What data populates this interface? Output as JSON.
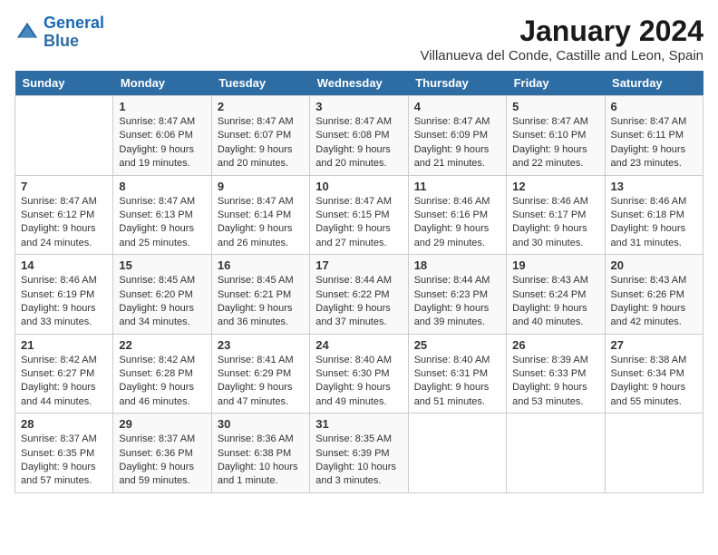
{
  "logo": {
    "line1": "General",
    "line2": "Blue"
  },
  "title": "January 2024",
  "subtitle": "Villanueva del Conde, Castille and Leon, Spain",
  "weekdays": [
    "Sunday",
    "Monday",
    "Tuesday",
    "Wednesday",
    "Thursday",
    "Friday",
    "Saturday"
  ],
  "weeks": [
    [
      {
        "day": "",
        "sunrise": "",
        "sunset": "",
        "daylight": ""
      },
      {
        "day": "1",
        "sunrise": "Sunrise: 8:47 AM",
        "sunset": "Sunset: 6:06 PM",
        "daylight": "Daylight: 9 hours and 19 minutes."
      },
      {
        "day": "2",
        "sunrise": "Sunrise: 8:47 AM",
        "sunset": "Sunset: 6:07 PM",
        "daylight": "Daylight: 9 hours and 20 minutes."
      },
      {
        "day": "3",
        "sunrise": "Sunrise: 8:47 AM",
        "sunset": "Sunset: 6:08 PM",
        "daylight": "Daylight: 9 hours and 20 minutes."
      },
      {
        "day": "4",
        "sunrise": "Sunrise: 8:47 AM",
        "sunset": "Sunset: 6:09 PM",
        "daylight": "Daylight: 9 hours and 21 minutes."
      },
      {
        "day": "5",
        "sunrise": "Sunrise: 8:47 AM",
        "sunset": "Sunset: 6:10 PM",
        "daylight": "Daylight: 9 hours and 22 minutes."
      },
      {
        "day": "6",
        "sunrise": "Sunrise: 8:47 AM",
        "sunset": "Sunset: 6:11 PM",
        "daylight": "Daylight: 9 hours and 23 minutes."
      }
    ],
    [
      {
        "day": "7",
        "sunrise": "Sunrise: 8:47 AM",
        "sunset": "Sunset: 6:12 PM",
        "daylight": "Daylight: 9 hours and 24 minutes."
      },
      {
        "day": "8",
        "sunrise": "Sunrise: 8:47 AM",
        "sunset": "Sunset: 6:13 PM",
        "daylight": "Daylight: 9 hours and 25 minutes."
      },
      {
        "day": "9",
        "sunrise": "Sunrise: 8:47 AM",
        "sunset": "Sunset: 6:14 PM",
        "daylight": "Daylight: 9 hours and 26 minutes."
      },
      {
        "day": "10",
        "sunrise": "Sunrise: 8:47 AM",
        "sunset": "Sunset: 6:15 PM",
        "daylight": "Daylight: 9 hours and 27 minutes."
      },
      {
        "day": "11",
        "sunrise": "Sunrise: 8:46 AM",
        "sunset": "Sunset: 6:16 PM",
        "daylight": "Daylight: 9 hours and 29 minutes."
      },
      {
        "day": "12",
        "sunrise": "Sunrise: 8:46 AM",
        "sunset": "Sunset: 6:17 PM",
        "daylight": "Daylight: 9 hours and 30 minutes."
      },
      {
        "day": "13",
        "sunrise": "Sunrise: 8:46 AM",
        "sunset": "Sunset: 6:18 PM",
        "daylight": "Daylight: 9 hours and 31 minutes."
      }
    ],
    [
      {
        "day": "14",
        "sunrise": "Sunrise: 8:46 AM",
        "sunset": "Sunset: 6:19 PM",
        "daylight": "Daylight: 9 hours and 33 minutes."
      },
      {
        "day": "15",
        "sunrise": "Sunrise: 8:45 AM",
        "sunset": "Sunset: 6:20 PM",
        "daylight": "Daylight: 9 hours and 34 minutes."
      },
      {
        "day": "16",
        "sunrise": "Sunrise: 8:45 AM",
        "sunset": "Sunset: 6:21 PM",
        "daylight": "Daylight: 9 hours and 36 minutes."
      },
      {
        "day": "17",
        "sunrise": "Sunrise: 8:44 AM",
        "sunset": "Sunset: 6:22 PM",
        "daylight": "Daylight: 9 hours and 37 minutes."
      },
      {
        "day": "18",
        "sunrise": "Sunrise: 8:44 AM",
        "sunset": "Sunset: 6:23 PM",
        "daylight": "Daylight: 9 hours and 39 minutes."
      },
      {
        "day": "19",
        "sunrise": "Sunrise: 8:43 AM",
        "sunset": "Sunset: 6:24 PM",
        "daylight": "Daylight: 9 hours and 40 minutes."
      },
      {
        "day": "20",
        "sunrise": "Sunrise: 8:43 AM",
        "sunset": "Sunset: 6:26 PM",
        "daylight": "Daylight: 9 hours and 42 minutes."
      }
    ],
    [
      {
        "day": "21",
        "sunrise": "Sunrise: 8:42 AM",
        "sunset": "Sunset: 6:27 PM",
        "daylight": "Daylight: 9 hours and 44 minutes."
      },
      {
        "day": "22",
        "sunrise": "Sunrise: 8:42 AM",
        "sunset": "Sunset: 6:28 PM",
        "daylight": "Daylight: 9 hours and 46 minutes."
      },
      {
        "day": "23",
        "sunrise": "Sunrise: 8:41 AM",
        "sunset": "Sunset: 6:29 PM",
        "daylight": "Daylight: 9 hours and 47 minutes."
      },
      {
        "day": "24",
        "sunrise": "Sunrise: 8:40 AM",
        "sunset": "Sunset: 6:30 PM",
        "daylight": "Daylight: 9 hours and 49 minutes."
      },
      {
        "day": "25",
        "sunrise": "Sunrise: 8:40 AM",
        "sunset": "Sunset: 6:31 PM",
        "daylight": "Daylight: 9 hours and 51 minutes."
      },
      {
        "day": "26",
        "sunrise": "Sunrise: 8:39 AM",
        "sunset": "Sunset: 6:33 PM",
        "daylight": "Daylight: 9 hours and 53 minutes."
      },
      {
        "day": "27",
        "sunrise": "Sunrise: 8:38 AM",
        "sunset": "Sunset: 6:34 PM",
        "daylight": "Daylight: 9 hours and 55 minutes."
      }
    ],
    [
      {
        "day": "28",
        "sunrise": "Sunrise: 8:37 AM",
        "sunset": "Sunset: 6:35 PM",
        "daylight": "Daylight: 9 hours and 57 minutes."
      },
      {
        "day": "29",
        "sunrise": "Sunrise: 8:37 AM",
        "sunset": "Sunset: 6:36 PM",
        "daylight": "Daylight: 9 hours and 59 minutes."
      },
      {
        "day": "30",
        "sunrise": "Sunrise: 8:36 AM",
        "sunset": "Sunset: 6:38 PM",
        "daylight": "Daylight: 10 hours and 1 minute."
      },
      {
        "day": "31",
        "sunrise": "Sunrise: 8:35 AM",
        "sunset": "Sunset: 6:39 PM",
        "daylight": "Daylight: 10 hours and 3 minutes."
      },
      {
        "day": "",
        "sunrise": "",
        "sunset": "",
        "daylight": ""
      },
      {
        "day": "",
        "sunrise": "",
        "sunset": "",
        "daylight": ""
      },
      {
        "day": "",
        "sunrise": "",
        "sunset": "",
        "daylight": ""
      }
    ]
  ]
}
